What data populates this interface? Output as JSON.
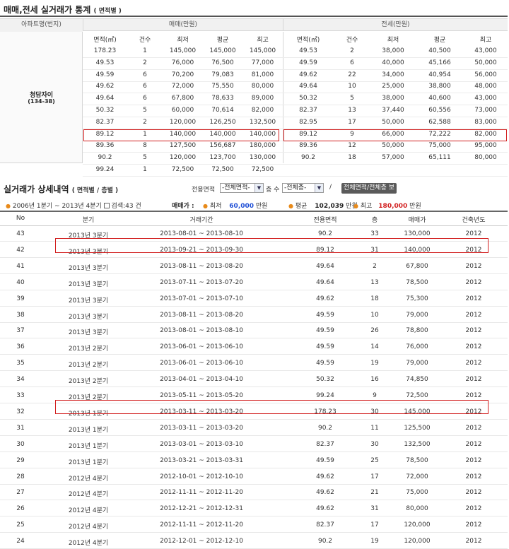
{
  "stats": {
    "title": "매매,전세 실거래가 통계",
    "title_sub": "( 면적별 )",
    "col_apt": "아파트명(번지)",
    "col_sale": "매매(만원)",
    "col_rent": "전세(만원)",
    "apt_name": "청담자이",
    "apt_lot": "(134-38)",
    "sub_sale": [
      "면적(㎡)",
      "건수",
      "최저",
      "평균",
      "최고"
    ],
    "sub_rent": [
      "면적(㎡)",
      "건수",
      "최저",
      "평균",
      "최고"
    ],
    "sale_rows": [
      [
        "178.23",
        "1",
        "145,000",
        "145,000",
        "145,000"
      ],
      [
        "49.53",
        "2",
        "76,000",
        "76,500",
        "77,000"
      ],
      [
        "49.59",
        "6",
        "70,200",
        "79,083",
        "81,000"
      ],
      [
        "49.62",
        "6",
        "72,000",
        "75,550",
        "80,000"
      ],
      [
        "49.64",
        "6",
        "67,800",
        "78,633",
        "89,000"
      ],
      [
        "50.32",
        "5",
        "60,000",
        "70,614",
        "82,000"
      ],
      [
        "82.37",
        "2",
        "120,000",
        "126,250",
        "132,500"
      ],
      [
        "89.12",
        "1",
        "140,000",
        "140,000",
        "140,000"
      ],
      [
        "89.36",
        "8",
        "127,500",
        "156,687",
        "180,000"
      ],
      [
        "90.2",
        "5",
        "120,000",
        "123,700",
        "130,000"
      ],
      [
        "99.24",
        "1",
        "72,500",
        "72,500",
        "72,500"
      ]
    ],
    "rent_rows": [
      [
        "49.53",
        "2",
        "38,000",
        "40,500",
        "43,000"
      ],
      [
        "49.59",
        "6",
        "40,000",
        "45,166",
        "50,000"
      ],
      [
        "49.62",
        "22",
        "34,000",
        "40,954",
        "56,000"
      ],
      [
        "49.64",
        "10",
        "25,000",
        "38,800",
        "48,000"
      ],
      [
        "50.32",
        "5",
        "38,000",
        "40,600",
        "43,000"
      ],
      [
        "82.37",
        "13",
        "37,440",
        "60,556",
        "73,000"
      ],
      [
        "82.95",
        "17",
        "50,000",
        "62,588",
        "83,000"
      ],
      [
        "89.12",
        "9",
        "66,000",
        "72,222",
        "82,000"
      ],
      [
        "89.36",
        "12",
        "50,000",
        "75,000",
        "95,000"
      ],
      [
        "90.2",
        "18",
        "57,000",
        "65,111",
        "80,000"
      ]
    ]
  },
  "detail": {
    "title": "실거래가 상세내역",
    "title_sub": "( 면적별 / 층별 )",
    "filter_area_label": "전용면적",
    "filter_area_value": "-전체면적-",
    "filter_floor_label": "층 수",
    "filter_floor_value": "-전체층-",
    "slash": "/",
    "view_all_button": "전체면적/전체층 보기",
    "summary_period": "2006년 1분기 ~ 2013년 4분기",
    "summary_count": "검색:43 건",
    "summary_sale_label": "매매가 :",
    "summary_min_label": "최저",
    "summary_min_value": "60,000",
    "summary_avg_label": "평균",
    "summary_avg_value": "102,039",
    "summary_max_label": "최고",
    "summary_max_value": "180,000",
    "unit": "만원",
    "headers": [
      "No",
      "분기",
      "거래기간",
      "전용면적",
      "층",
      "매매가",
      "건축년도"
    ],
    "rows": [
      [
        "43",
        "2013년 3분기",
        "2013-08-01 ~ 2013-08-10",
        "90.2",
        "33",
        "130,000",
        "2012"
      ],
      [
        "42",
        "2013년 3분기",
        "2013-09-21 ~ 2013-09-30",
        "89.12",
        "31",
        "140,000",
        "2012"
      ],
      [
        "41",
        "2013년 3분기",
        "2013-08-11 ~ 2013-08-20",
        "49.64",
        "2",
        "67,800",
        "2012"
      ],
      [
        "40",
        "2013년 3분기",
        "2013-07-11 ~ 2013-07-20",
        "49.64",
        "13",
        "78,500",
        "2012"
      ],
      [
        "39",
        "2013년 3분기",
        "2013-07-01 ~ 2013-07-10",
        "49.62",
        "18",
        "75,300",
        "2012"
      ],
      [
        "38",
        "2013년 3분기",
        "2013-08-11 ~ 2013-08-20",
        "49.59",
        "10",
        "79,000",
        "2012"
      ],
      [
        "37",
        "2013년 3분기",
        "2013-08-01 ~ 2013-08-10",
        "49.59",
        "26",
        "78,800",
        "2012"
      ],
      [
        "36",
        "2013년 2분기",
        "2013-06-01 ~ 2013-06-10",
        "49.59",
        "14",
        "76,000",
        "2012"
      ],
      [
        "35",
        "2013년 2분기",
        "2013-06-01 ~ 2013-06-10",
        "49.59",
        "19",
        "79,000",
        "2012"
      ],
      [
        "34",
        "2013년 2분기",
        "2013-04-01 ~ 2013-04-10",
        "50.32",
        "16",
        "74,850",
        "2012"
      ],
      [
        "33",
        "2013년 2분기",
        "2013-05-11 ~ 2013-05-20",
        "99.24",
        "9",
        "72,500",
        "2012"
      ],
      [
        "32",
        "2013년 1분기",
        "2013-03-11 ~ 2013-03-20",
        "178.23",
        "30",
        "145,000",
        "2012"
      ],
      [
        "31",
        "2013년 1분기",
        "2013-03-11 ~ 2013-03-20",
        "90.2",
        "11",
        "125,500",
        "2012"
      ],
      [
        "30",
        "2013년 1분기",
        "2013-03-01 ~ 2013-03-10",
        "82.37",
        "30",
        "132,500",
        "2012"
      ],
      [
        "29",
        "2013년 1분기",
        "2013-03-21 ~ 2013-03-31",
        "49.59",
        "25",
        "78,500",
        "2012"
      ],
      [
        "28",
        "2012년 4분기",
        "2012-10-01 ~ 2012-10-10",
        "49.62",
        "17",
        "72,000",
        "2012"
      ],
      [
        "27",
        "2012년 4분기",
        "2012-11-11 ~ 2012-11-20",
        "49.62",
        "21",
        "75,000",
        "2012"
      ],
      [
        "26",
        "2012년 4분기",
        "2012-12-21 ~ 2012-12-31",
        "49.62",
        "31",
        "80,000",
        "2012"
      ],
      [
        "25",
        "2012년 4분기",
        "2012-11-11 ~ 2012-11-20",
        "82.37",
        "17",
        "120,000",
        "2012"
      ],
      [
        "24",
        "2012년 4분기",
        "2012-12-01 ~ 2012-12-10",
        "90.2",
        "19",
        "120,000",
        "2012"
      ]
    ]
  }
}
